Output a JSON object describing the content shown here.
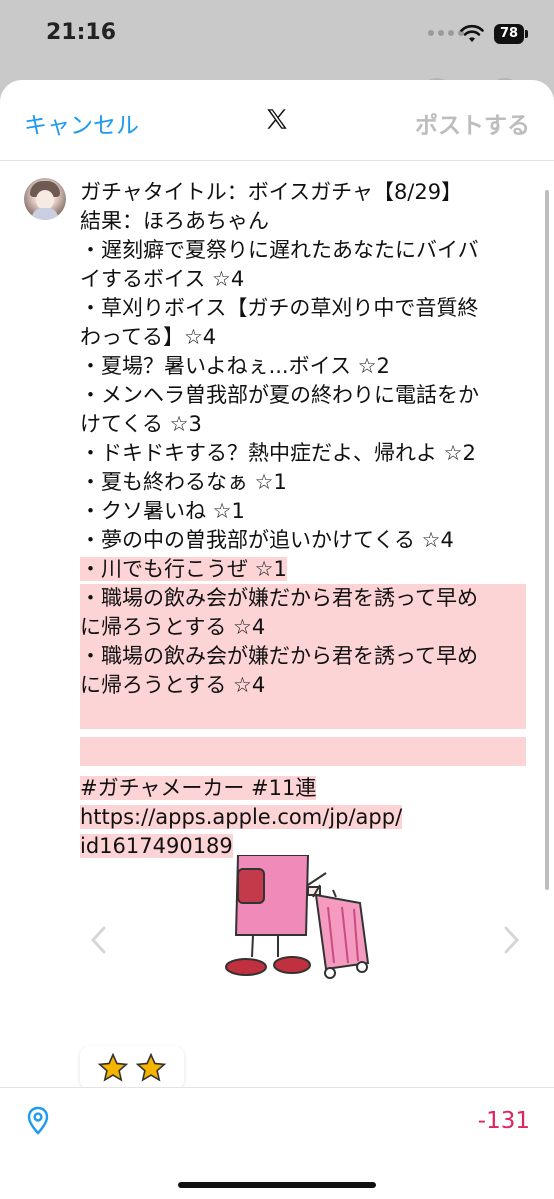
{
  "status_bar": {
    "time": "21:16",
    "battery": "78"
  },
  "nav": {
    "cancel_label": "キャンセル",
    "post_label": "ポストする"
  },
  "tweet": {
    "lines": [
      "ガチャタイトル：ボイスガチャ【8/29】",
      "結果：ほろあちゃん",
      "・遅刻癖で夏祭りに遅れたあなたにバイバ",
      "イするボイス ☆4",
      "・草刈りボイス【ガチの草刈り中で音質終",
      "わってる】☆4",
      "・夏場？暑いよねぇ...ボイス ☆2",
      "・メンヘラ曽我部が夏の終わりに電話をか",
      "けてくる ☆3",
      "・ドキドキする？熱中症だよ、帰れよ ☆2",
      "・夏も終わるなぁ ☆1",
      "・クソ暑いね ☆1",
      "・夢の中の曽我部が追いかけてくる ☆4"
    ],
    "highlighted_lines": [
      "・川でも行こうぜ ☆1",
      "・職場の飲み会が嫌だから君を誘って早め",
      "に帰ろうとする ☆4",
      "・職場の飲み会が嫌だから君を誘って早め",
      "に帰ろうとする ☆4",
      "",
      "",
      "#ガチャメーカー #11連",
      "https://apps.apple.com/jp/app/",
      "id1617490189"
    ]
  },
  "bottom": {
    "remaining_count": "-131"
  },
  "icons": [
    "x-logo-icon",
    "location-pin-icon",
    "chevron-left-icon",
    "chevron-right-icon",
    "star-icon"
  ],
  "colors": {
    "accent": "#1d9bf0",
    "highlight": "#fcd4d6",
    "over_limit": "#e0245e",
    "disabled": "#bdbdbd"
  }
}
